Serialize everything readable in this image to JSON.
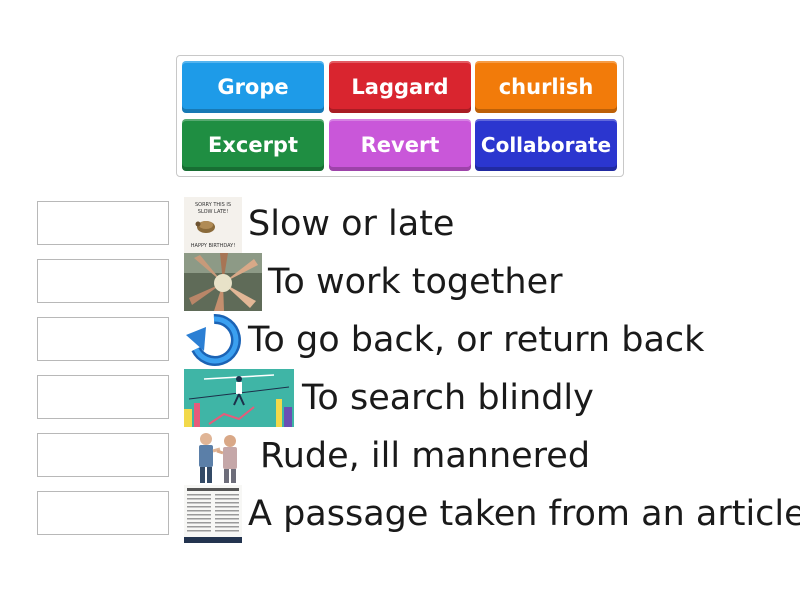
{
  "word_bank": [
    {
      "label": "Grope",
      "color": "#1e9be8"
    },
    {
      "label": "Laggard",
      "color": "#d9252f"
    },
    {
      "label": "churlish",
      "color": "#f27b0a"
    },
    {
      "label": "Excerpt",
      "color": "#1f8e42"
    },
    {
      "label": "Revert",
      "color": "#c957d9"
    },
    {
      "label": "Collaborate",
      "color": "#2b36cf"
    }
  ],
  "rows": [
    {
      "definition": "Slow or late",
      "image_icon": "birthday-card-image",
      "image_text": [
        "SORRY THIS IS",
        "SLOW LATE!",
        "HAPPY BIRTHDAY!"
      ]
    },
    {
      "definition": "To work together",
      "image_icon": "hands-together-image"
    },
    {
      "definition": "To go back, or return back",
      "image_icon": "undo-arrow-image"
    },
    {
      "definition": "To search blindly",
      "image_icon": "tightrope-walker-image"
    },
    {
      "definition": "Rude, ill mannered",
      "image_icon": "arguing-people-image"
    },
    {
      "definition": "A passage taken from an article",
      "image_icon": "newspaper-article-image"
    }
  ]
}
